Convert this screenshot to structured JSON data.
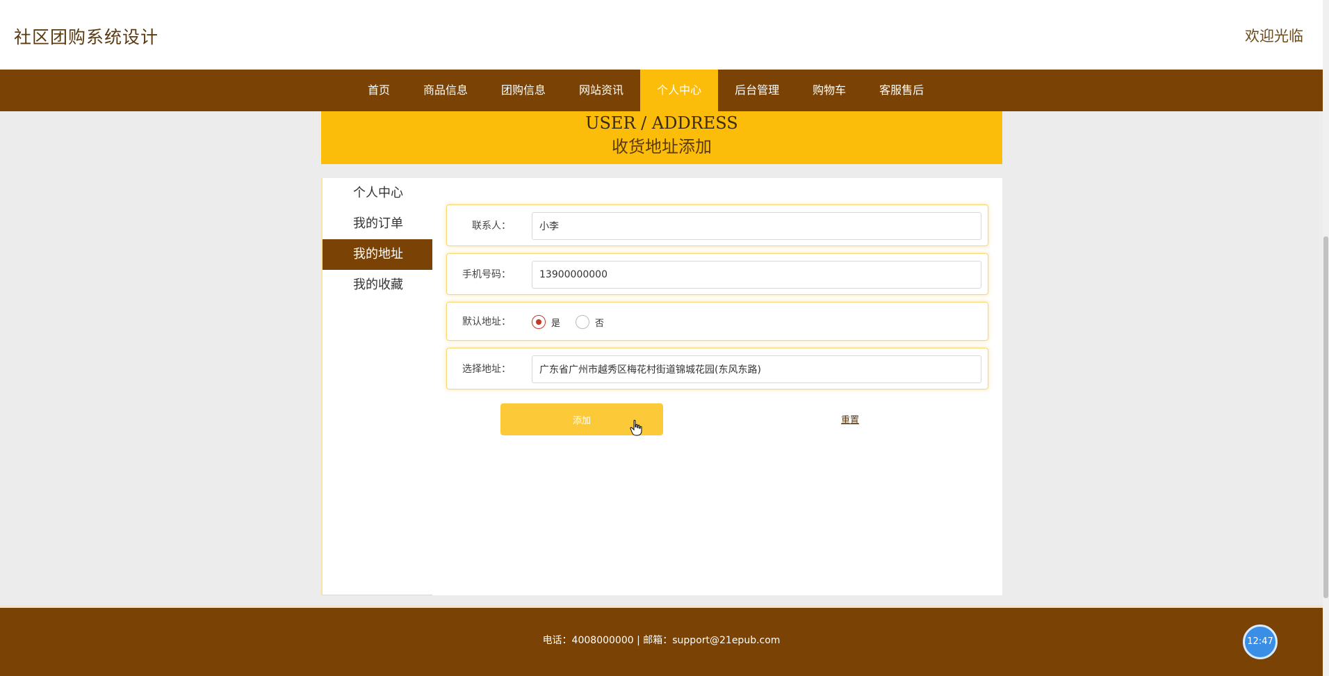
{
  "header": {
    "site_title": "社区团购系统设计",
    "welcome": "欢迎光临"
  },
  "nav": {
    "items": [
      {
        "label": "首页"
      },
      {
        "label": "商品信息"
      },
      {
        "label": "团购信息"
      },
      {
        "label": "网站资讯"
      },
      {
        "label": "个人中心",
        "active": true
      },
      {
        "label": "后台管理"
      },
      {
        "label": "购物车"
      },
      {
        "label": "客服售后"
      }
    ]
  },
  "banner": {
    "english": "USER / ADDRESS",
    "chinese": "收货地址添加"
  },
  "sidebar": {
    "items": [
      {
        "label": "个人中心"
      },
      {
        "label": "我的订单"
      },
      {
        "label": "我的地址",
        "active": true
      },
      {
        "label": "我的收藏"
      }
    ]
  },
  "form": {
    "contact_label": "联系人：",
    "contact_value": "小李",
    "phone_label": "手机号码：",
    "phone_value": "13900000000",
    "default_label": "默认地址：",
    "default_yes": "是",
    "default_no": "否",
    "default_selected": "是",
    "address_label": "选择地址：",
    "address_value": "广东省广州市越秀区梅花村街道锦城花园(东风东路)"
  },
  "actions": {
    "add_label": "添加",
    "reset_label": "重置"
  },
  "footer": {
    "text": "电话：4008000000 | 邮箱：support@21epub.com"
  },
  "clock": {
    "time": "12:47"
  },
  "colors": {
    "brown": "#7a4305",
    "gold": "#fcbd0a",
    "button": "#fcca38"
  }
}
